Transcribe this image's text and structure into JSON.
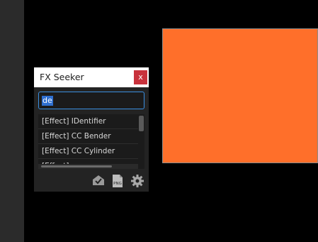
{
  "panel": {
    "title": "FX Seeker",
    "close_label": "x"
  },
  "search": {
    "value": "de"
  },
  "results": [
    "[Effect] IDentifier",
    "[Effect] CC Bender",
    "[Effect] CC Cylinder"
  ],
  "toolbar": {
    "icons": [
      "tag-check-icon",
      "png-file-icon",
      "gear-icon"
    ],
    "png_label": "PNG"
  },
  "colors": {
    "layer": "#ff6f2a",
    "close": "#c8323c",
    "focus": "#3a8fe0"
  }
}
